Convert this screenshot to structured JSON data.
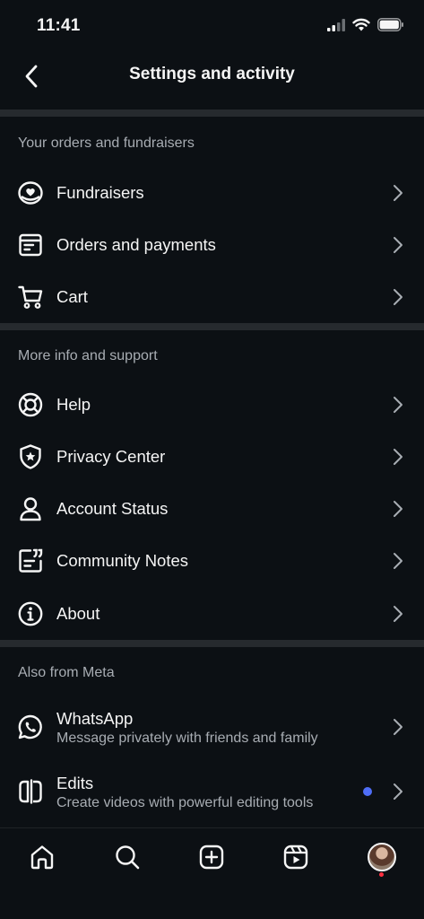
{
  "status_bar": {
    "time": "11:41"
  },
  "header": {
    "title": "Settings and activity"
  },
  "sections": [
    {
      "title": "Your orders and fundraisers",
      "items": [
        {
          "label": "Fundraisers",
          "icon": "fundraiser-heart-icon"
        },
        {
          "label": "Orders and payments",
          "icon": "orders-box-icon"
        },
        {
          "label": "Cart",
          "icon": "cart-icon"
        }
      ]
    },
    {
      "title": "More info and support",
      "items": [
        {
          "label": "Help",
          "icon": "lifebuoy-icon"
        },
        {
          "label": "Privacy Center",
          "icon": "shield-star-icon"
        },
        {
          "label": "Account Status",
          "icon": "person-icon"
        },
        {
          "label": "Community Notes",
          "icon": "community-notes-icon"
        },
        {
          "label": "About",
          "icon": "info-icon"
        }
      ]
    },
    {
      "title": "Also from Meta",
      "items": [
        {
          "label": "WhatsApp",
          "sub": "Message privately with friends and family",
          "icon": "whatsapp-icon"
        },
        {
          "label": "Edits",
          "sub": "Create videos with powerful editing tools",
          "icon": "edits-icon",
          "badge": "new-dot"
        }
      ]
    }
  ],
  "bottom_nav": [
    {
      "icon": "home-icon"
    },
    {
      "icon": "search-icon"
    },
    {
      "icon": "create-plus-icon"
    },
    {
      "icon": "reels-icon"
    },
    {
      "icon": "profile-avatar"
    }
  ],
  "colors": {
    "background": "#0c1014",
    "text": "#f5f5f5",
    "secondary": "#a8adb3",
    "divider": "#262a2e",
    "accent_dot": "#4f6ef7",
    "notification": "#ff3040"
  }
}
